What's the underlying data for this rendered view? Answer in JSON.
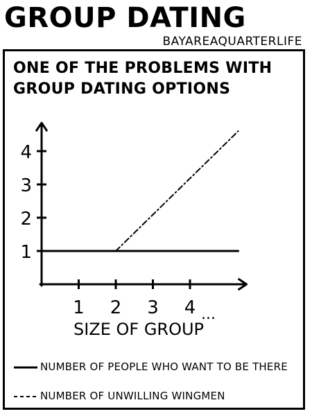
{
  "header": {
    "title": "GROUP DATING",
    "credit": "BAYAREAQUARTERLIFE"
  },
  "colors": {
    "ink": "#000000",
    "background": "#ffffff"
  },
  "chart_data": {
    "type": "line",
    "title": "ONE OF THE PROBLEMS WITH GROUP DATING OPTIONS",
    "xlabel": "SIZE OF GROUP",
    "ylabel": "",
    "x_ticks": [
      "1",
      "2",
      "3",
      "4"
    ],
    "x_tick_suffix": "...",
    "y_ticks": [
      "1",
      "2",
      "3",
      "4"
    ],
    "xlim": [
      0,
      5.3
    ],
    "ylim": [
      0,
      4.6
    ],
    "grid": false,
    "legend_placement": "bottom",
    "series": [
      {
        "name": "NUMBER OF PEOPLE WHO WANT TO BE THERE",
        "style": "solid",
        "x": [
          0,
          5.3
        ],
        "y": [
          1,
          1
        ]
      },
      {
        "name": "NUMBER OF UNWILLING WINGMEN",
        "style": "dashed",
        "x": [
          2,
          5.3
        ],
        "y": [
          1,
          4.6
        ]
      }
    ]
  }
}
